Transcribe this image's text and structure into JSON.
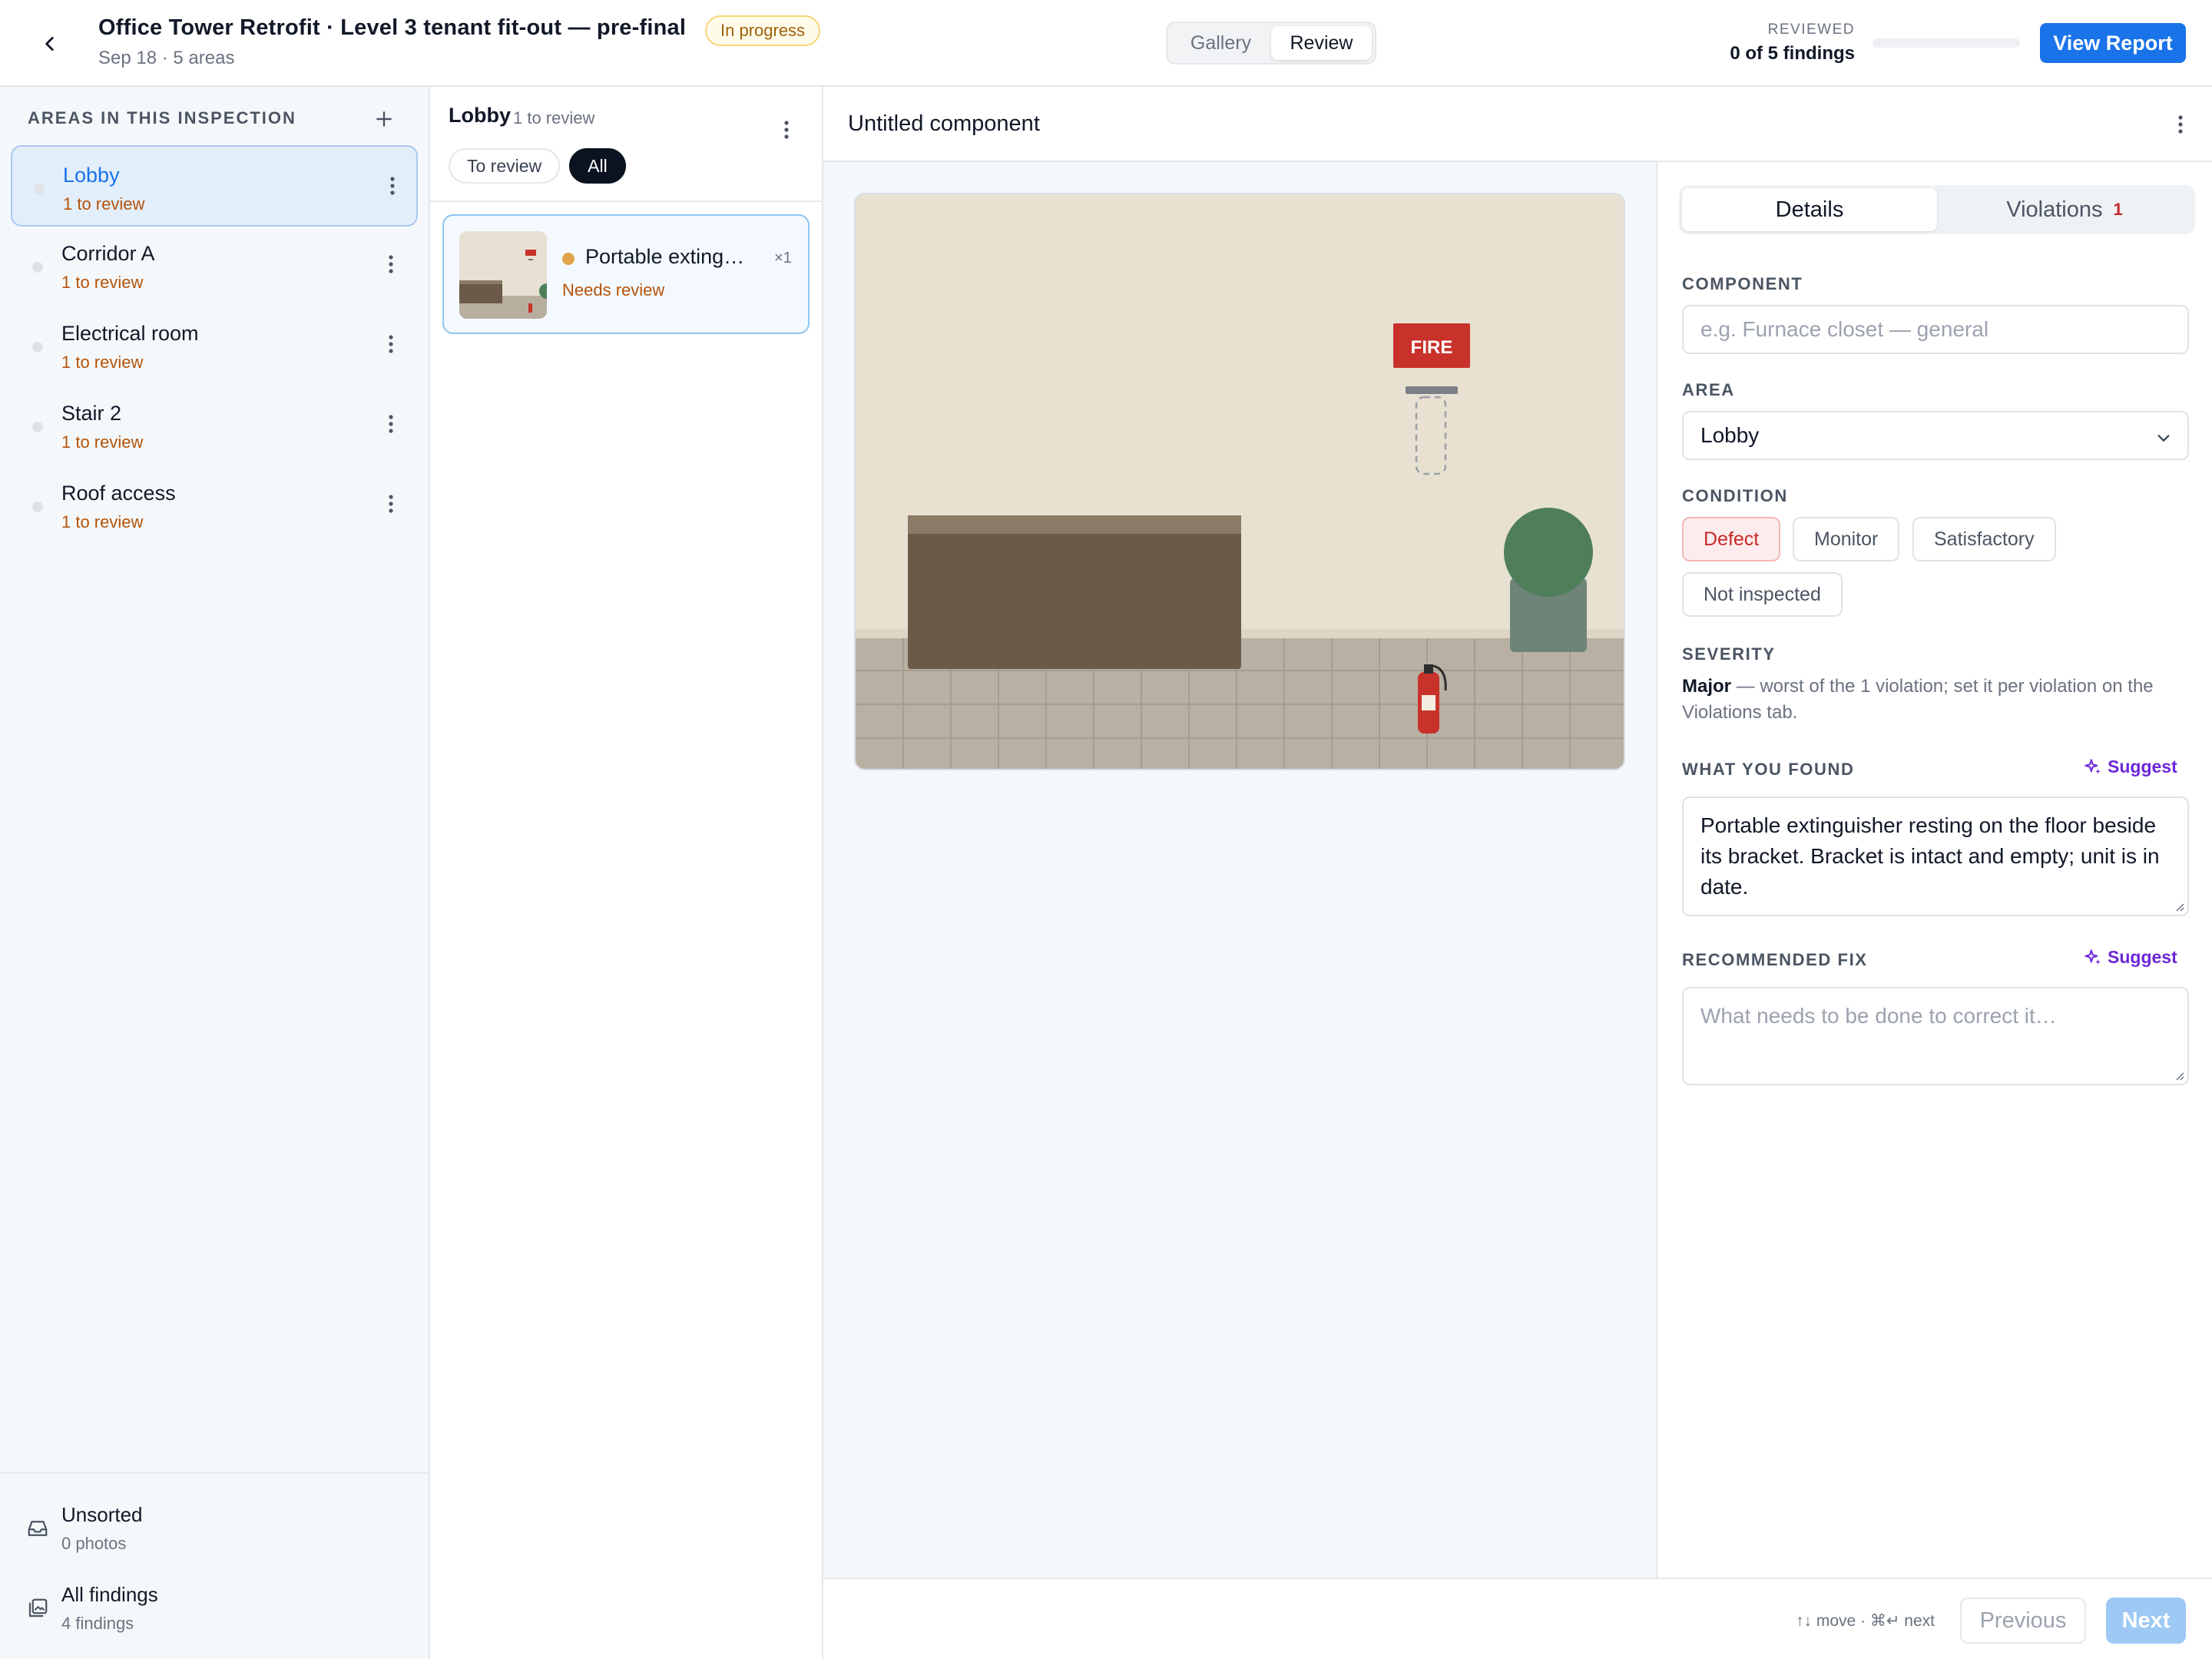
{
  "header": {
    "title": "Office Tower Retrofit · Level 3 tenant fit-out — pre-final",
    "status": "In progress",
    "subtitle": "Sep 18 · 5 areas",
    "view_tabs": [
      "Gallery",
      "Review"
    ],
    "active_view": "Review",
    "reviewed_label": "REVIEWED",
    "reviewed_count": "0 of 5 findings",
    "reviewed_progress": 0,
    "view_report_label": "View Report",
    "accent_color": "#1a73e8"
  },
  "sidebar": {
    "heading": "AREAS IN THIS INSPECTION",
    "areas": [
      {
        "name": "Lobby",
        "count": "1 to review",
        "active": true
      },
      {
        "name": "Corridor A",
        "count": "1 to review"
      },
      {
        "name": "Electrical room",
        "count": "1 to review"
      },
      {
        "name": "Stair 2",
        "count": "1 to review"
      },
      {
        "name": "Roof access",
        "count": "1 to review"
      }
    ],
    "bottom": [
      {
        "title": "Unsorted",
        "sub": "0 photos",
        "icon": "inbox-icon"
      },
      {
        "title": "All findings",
        "sub": "4 findings",
        "icon": "images-icon"
      }
    ]
  },
  "list": {
    "title": "Lobby",
    "count": "1 to review",
    "filters": [
      "To review",
      "All"
    ],
    "active_filter": "All",
    "findings": [
      {
        "name": "Portable extinguisher",
        "count": "×1",
        "status": "Needs review",
        "status_color": "#e0a24a"
      }
    ]
  },
  "viewer": {
    "title": "Untitled component",
    "photo_sign_text": "FIRE"
  },
  "panel": {
    "tabs": [
      "Details",
      "Violations"
    ],
    "active_tab": "Details",
    "violations_count": "1",
    "component_label": "COMPONENT",
    "component_placeholder": "e.g. Furnace closet — general",
    "area_label": "AREA",
    "area_value": "Lobby",
    "condition_label": "CONDITION",
    "conditions": [
      "Defect",
      "Monitor",
      "Satisfactory",
      "Not inspected"
    ],
    "active_condition": "Defect",
    "severity_label": "SEVERITY",
    "severity_value": "Major",
    "severity_note": " — worst of the 1 violation; set it per violation on the Violations tab.",
    "found_label": "WHAT YOU FOUND",
    "suggest_label": "Suggest",
    "found_text": "Portable extinguisher resting on the floor beside its bracket. Bracket is intact and empty; unit is in date.",
    "fix_label": "RECOMMENDED FIX",
    "fix_placeholder": "What needs to be done to correct it…"
  },
  "footer": {
    "hint": "↑↓ move · ⌘↵ next",
    "previous_label": "Previous",
    "next_label": "Next"
  }
}
